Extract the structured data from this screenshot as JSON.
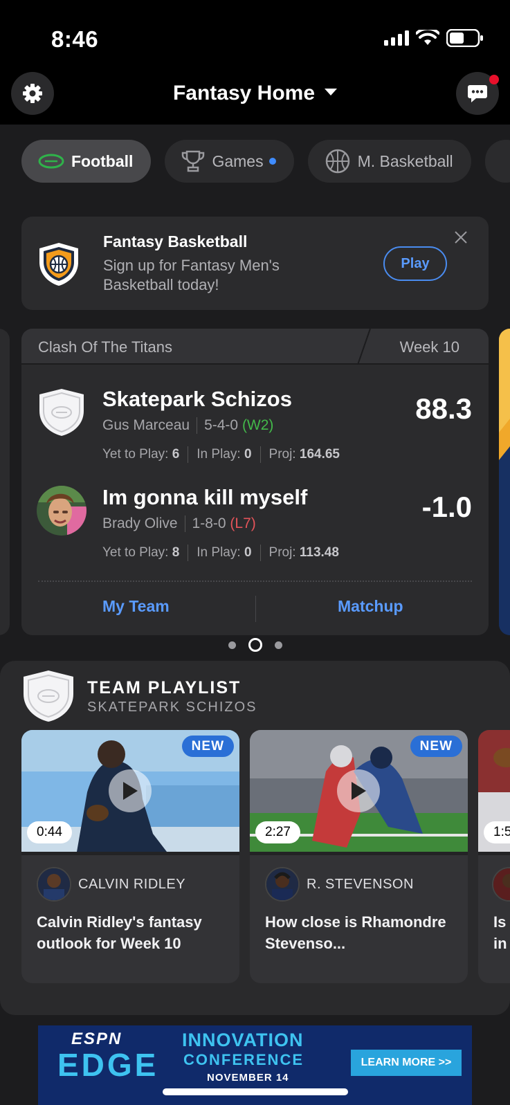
{
  "status_bar": {
    "time": "8:46"
  },
  "header": {
    "title": "Fantasy Home"
  },
  "sport_tabs": [
    {
      "label": "Football",
      "active": true
    },
    {
      "label": "Games",
      "active": false,
      "indicator": true
    },
    {
      "label": "M. Basketball",
      "active": false
    }
  ],
  "promo": {
    "title": "Fantasy Basketball",
    "text": "Sign up for Fantasy Men's Basketball today!",
    "button": "Play"
  },
  "matchup": {
    "league": "Clash Of The Titans",
    "week": "Week 10",
    "teams": [
      {
        "name": "Skatepark Schizos",
        "owner": "Gus Marceau",
        "record": "5-4-0",
        "streak": "(W2)",
        "score": "88.3",
        "yet_to_play_label": "Yet to Play:",
        "yet_to_play": "6",
        "in_play_label": "In Play:",
        "in_play": "0",
        "proj_label": "Proj:",
        "proj": "164.65"
      },
      {
        "name": "Im gonna kill myself",
        "owner": "Brady Olive",
        "record": "1-8-0",
        "streak": "(L7)",
        "score": "-1.0",
        "yet_to_play_label": "Yet to Play:",
        "yet_to_play": "8",
        "in_play_label": "In Play:",
        "in_play": "0",
        "proj_label": "Proj:",
        "proj": "113.48"
      }
    ],
    "link_my_team": "My Team",
    "link_matchup": "Matchup"
  },
  "pager": {
    "count": 3,
    "current": 2
  },
  "playlist": {
    "title": "TEAM PLAYLIST",
    "subtitle": "SKATEPARK SCHIZOS",
    "videos": [
      {
        "badge": "NEW",
        "duration": "0:44",
        "player": "CALVIN RIDLEY",
        "headline": "Calvin Ridley's fantasy outlook for Week 10"
      },
      {
        "badge": "NEW",
        "duration": "2:27",
        "player": "R. STEVENSON",
        "headline": "How close is Rhamondre Stevenso..."
      },
      {
        "duration": "1:5",
        "headline": "Is in"
      }
    ]
  },
  "ad": {
    "brand": "ESPN",
    "product": "EDGE",
    "line1": "INNOVATION",
    "line2": "CONFERENCE",
    "date": "NOVEMBER 14",
    "cta": "LEARN MORE >>"
  },
  "colors": {
    "accent_blue": "#5a9bff",
    "win_green": "#43b94a",
    "loss_red": "#e5545a",
    "notification_red": "#e8102b",
    "badge_blue": "#2a6fd6"
  }
}
